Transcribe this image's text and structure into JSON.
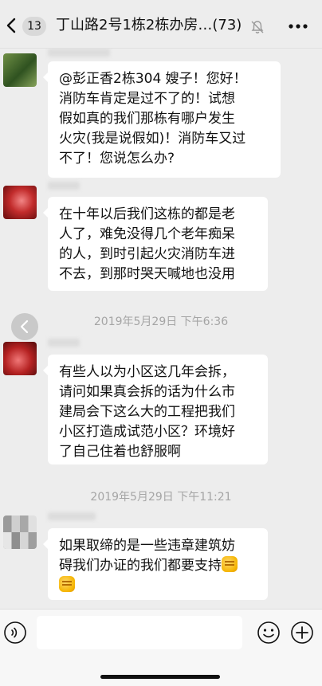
{
  "header": {
    "unread_count": "13",
    "title": "丁山路2号1栋2栋办房…(73)"
  },
  "messages": [
    {
      "lines": [
        "@彭正香2栋304 嫂子！您好！",
        "消防车肯定是过不了的！试想",
        "假如真的我们那栋有哪户发生",
        "火灾(我是说假如)！消防车又过",
        "不了！您说怎么办?"
      ]
    },
    {
      "lines": [
        "在十年以后我们这栋的都是老",
        "人了，难免没得几个老年痴呆",
        "的人，到时引起火灾消防车进",
        "不去，到那时哭天喊地也没用"
      ]
    },
    {
      "lines": [
        "有些人以为小区这几年会拆，",
        "请问如果真会拆的话为什么市",
        "建局会下这么大的工程把我们",
        "小区打造成试范小区？环境好",
        "了自己住着也舒服啊"
      ]
    },
    {
      "lines": [
        "如果取缔的是一些违章建筑妨",
        "碍我们办证的我们都要支持"
      ]
    }
  ],
  "timestamps": [
    "2019年5月29日 下午6:36",
    "2019年5月29日 下午11:21"
  ],
  "icons": {
    "back": "chevron-left-icon",
    "mute": "bell-slash-icon",
    "more": "more-dots-icon",
    "voice": "voice-icon",
    "emoji": "smile-icon",
    "plus": "plus-circle-icon",
    "fist": "fist-emoji-icon"
  },
  "colors": {
    "background": "#ededed",
    "bubble": "#ffffff",
    "timestamp_text": "#a5a5a5"
  }
}
